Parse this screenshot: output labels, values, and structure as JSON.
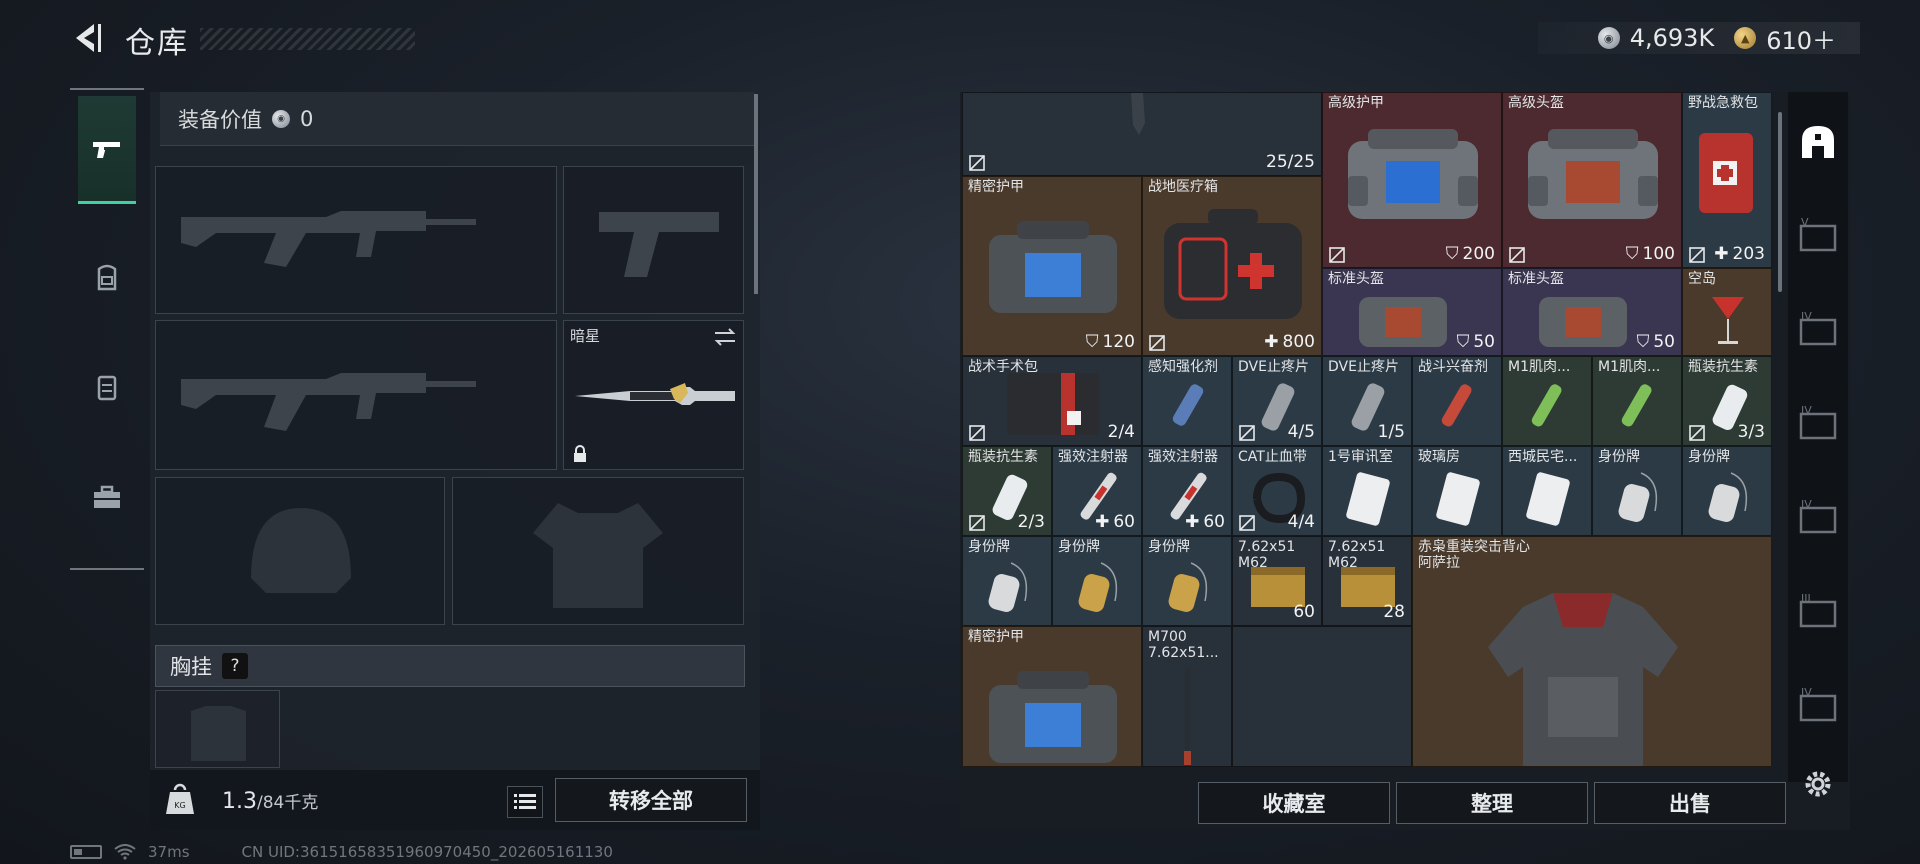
{
  "header": {
    "title": "仓库",
    "currency_silver": "4,693K",
    "currency_gold": "610＋"
  },
  "equipment": {
    "value_label": "装备价值",
    "value": "0",
    "melee_slot_label": "暗星",
    "chest_rig_label": "胸挂",
    "help_symbol": "?"
  },
  "weight": {
    "current": "1.3",
    "max": "/84千克"
  },
  "buttons": {
    "transfer_all": "转移全部",
    "collection_room": "收藏室",
    "organize": "整理",
    "sell": "出售"
  },
  "status": {
    "ping": "37ms",
    "uid": "CN UID:3615165835196097045​0_202605161130"
  },
  "inventory": {
    "top_row": {
      "qty": "25/25"
    },
    "items": [
      {
        "name": "高级护甲",
        "qty": "200",
        "badge": "shield"
      },
      {
        "name": "高级头盔",
        "qty": "100",
        "badge": "shield"
      },
      {
        "name": "野战急救包",
        "qty": "203",
        "badge": "plus"
      },
      {
        "name": "精密护甲",
        "qty": "120",
        "badge": "shield"
      },
      {
        "name": "战地医疗箱",
        "qty": "800",
        "badge": "plus"
      },
      {
        "name": "标准头盔",
        "qty": "50",
        "badge": "shield"
      },
      {
        "name": "标准头盔",
        "qty": "50",
        "badge": "shield"
      },
      {
        "name": "空岛",
        "qty": "",
        "badge": ""
      },
      {
        "name": "战术手术包",
        "qty": "2/4",
        "badge": ""
      },
      {
        "name": "感知强化剂",
        "qty": "",
        "badge": ""
      },
      {
        "name": "DVE止疼片",
        "qty": "4/5",
        "badge": ""
      },
      {
        "name": "DVE止疼片",
        "qty": "1/5",
        "badge": ""
      },
      {
        "name": "战斗兴奋剂",
        "qty": "",
        "badge": ""
      },
      {
        "name": "M1肌肉...",
        "qty": "",
        "badge": ""
      },
      {
        "name": "M1肌肉...",
        "qty": "",
        "badge": ""
      },
      {
        "name": "瓶装抗生素",
        "qty": "3/3",
        "badge": ""
      },
      {
        "name": "瓶装抗生素",
        "qty": "2/3",
        "badge": ""
      },
      {
        "name": "强效注射器",
        "qty": "60",
        "badge": "plus"
      },
      {
        "name": "强效注射器",
        "qty": "60",
        "badge": "plus"
      },
      {
        "name": "CAT止血带",
        "qty": "4/4",
        "badge": ""
      },
      {
        "name": "1号审讯室",
        "qty": "",
        "badge": ""
      },
      {
        "name": "玻璃房",
        "qty": "",
        "badge": ""
      },
      {
        "name": "西城民宅...",
        "qty": "",
        "badge": ""
      },
      {
        "name": "身份牌",
        "qty": "",
        "badge": ""
      },
      {
        "name": "身份牌",
        "qty": "",
        "badge": ""
      },
      {
        "name": "身份牌",
        "qty": "",
        "badge": ""
      },
      {
        "name": "身份牌",
        "qty": "",
        "badge": ""
      },
      {
        "name": "身份牌",
        "qty": "",
        "badge": ""
      },
      {
        "name": "7.62x51\nM62",
        "qty": "60",
        "badge": ""
      },
      {
        "name": "7.62x51\nM62",
        "qty": "28",
        "badge": ""
      },
      {
        "name": "赤枭重装突击背心\n阿萨拉",
        "qty": "",
        "badge": ""
      },
      {
        "name": "精密护甲",
        "qty": "",
        "badge": ""
      },
      {
        "name": "M700\n7.62x51...",
        "qty": "",
        "badge": ""
      }
    ]
  },
  "colors": {
    "accent": "#3fd1a4",
    "cell_red": "#4d2a2f",
    "cell_brown": "#4a3a2c",
    "cell_purple": "#3a3550"
  },
  "side_rail_icons": [
    "base-icon",
    "container-v-icon",
    "container-iv-icon",
    "container-iv-icon",
    "container-iv-icon",
    "container-iii-icon",
    "container-iv-icon",
    "settings-icon"
  ],
  "side_rail_labels": [
    "",
    "V",
    "IV",
    "IV",
    "IV",
    "III",
    "IV"
  ]
}
